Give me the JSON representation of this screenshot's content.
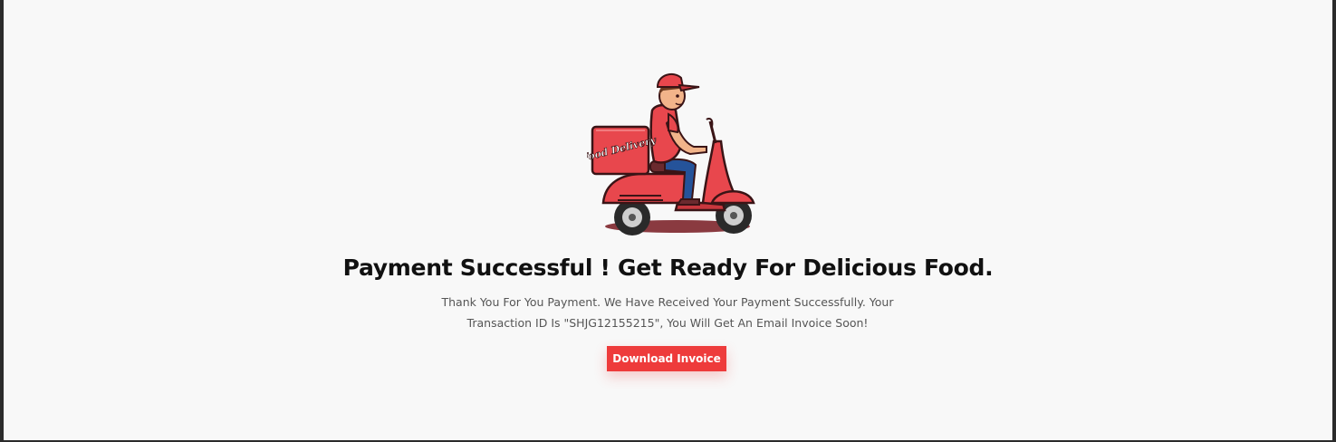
{
  "illustration": {
    "box_label": "Food Delivery"
  },
  "heading": "Payment Successful ! Get Ready For Delicious Food.",
  "message_line1": "Thank You For You Payment. We Have Received Your Payment Successfully. Your",
  "message_line2": "Transaction ID Is \"SHJG12155215\", You Will Get An Email Invoice Soon!",
  "download_button": "Download Invoice",
  "colors": {
    "accent": "#ee3b3b",
    "background": "#f8f8f8",
    "heading": "#111111",
    "body_text": "#555555"
  }
}
